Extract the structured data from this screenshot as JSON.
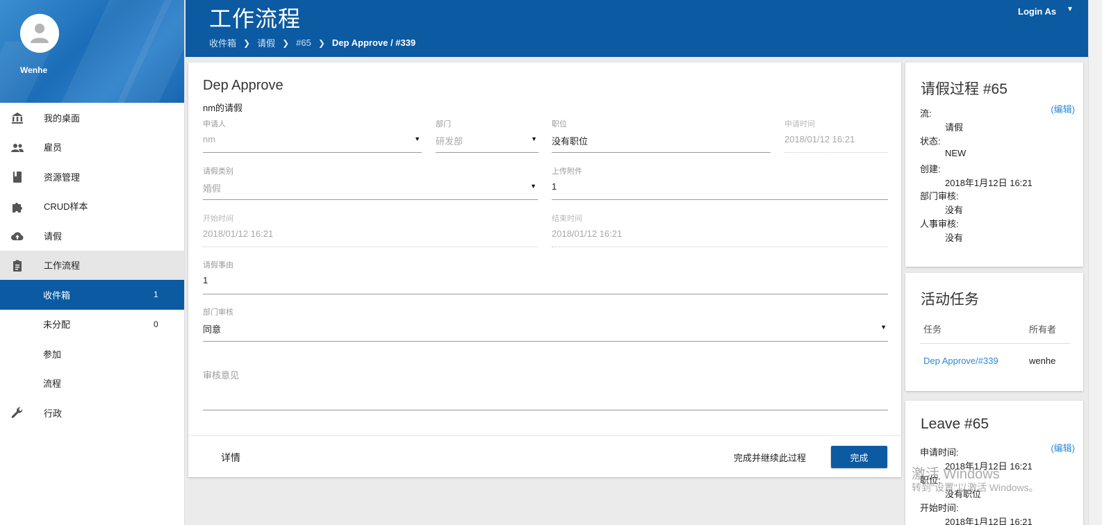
{
  "sidebar": {
    "username": "Wenhe",
    "items": [
      {
        "label": "我的桌面",
        "icon": "bank-icon"
      },
      {
        "label": "雇员",
        "icon": "people-icon"
      },
      {
        "label": "资源管理",
        "icon": "book-icon"
      },
      {
        "label": "CRUD样本",
        "icon": "puzzle-icon"
      },
      {
        "label": "请假",
        "icon": "cloud-upload-icon"
      },
      {
        "label": "工作流程",
        "icon": "clipboard-icon"
      }
    ],
    "sub_items": [
      {
        "label": "收件箱",
        "count": "1"
      },
      {
        "label": "未分配",
        "count": "0"
      },
      {
        "label": "参加",
        "count": ""
      },
      {
        "label": "流程",
        "count": ""
      }
    ],
    "admin": {
      "label": "行政",
      "icon": "wrench-icon"
    }
  },
  "header": {
    "title": "工作流程",
    "breadcrumb": [
      "收件箱",
      "请假",
      "#65",
      "Dep Approve / #339"
    ],
    "login_as": "Login As"
  },
  "form": {
    "title": "Dep Approve",
    "subtitle": "nm的请假",
    "applicant": {
      "label": "申请人",
      "value": "nm"
    },
    "department": {
      "label": "部门",
      "value": "研发部"
    },
    "position": {
      "label": "职位",
      "value": "没有职位"
    },
    "apply_time": {
      "label": "申请时间",
      "value": "2018/01/12 16:21"
    },
    "leave_type": {
      "label": "请假类别",
      "value": "婚假"
    },
    "attachment": {
      "label": "上传附件",
      "value": "1"
    },
    "start_time": {
      "label": "开始时间",
      "value": "2018/01/12 16:21"
    },
    "end_time": {
      "label": "结束时间",
      "value": "2018/01/12 16:21"
    },
    "reason": {
      "label": "请假事由",
      "value": "1"
    },
    "dept_review": {
      "label": "部门审核",
      "value": "同意"
    },
    "review_comment": {
      "label": "审核意见",
      "value": ""
    },
    "detail_button": "详情",
    "continue_button": "完成并继续此过程",
    "complete_button": "完成"
  },
  "process": {
    "title": "请假过程 #65",
    "edit": "(编辑)",
    "rows": [
      {
        "key": "流:",
        "value": "请假"
      },
      {
        "key": "状态:",
        "value": "NEW"
      },
      {
        "key": "创建:",
        "value": "2018年1月12日 16:21"
      },
      {
        "key": "部门审核:",
        "value": "没有"
      },
      {
        "key": "人事审核:",
        "value": "没有"
      }
    ]
  },
  "tasks": {
    "title": "活动任务",
    "col_task": "任务",
    "col_owner": "所有者",
    "row_task": "Dep Approve/#339",
    "row_owner": "wenhe"
  },
  "leave": {
    "title": "Leave #65",
    "edit": "(编辑)",
    "rows": [
      {
        "key": "申请时间:",
        "value": "2018年1月12日 16:21"
      },
      {
        "key": "职位:",
        "value": "没有职位"
      },
      {
        "key": "开始时间:",
        "value": "2018年1月12日 16:21"
      }
    ]
  },
  "watermark": {
    "line1": "激活 Windows",
    "line2": "转到\"设置\"以激活 Windows。"
  },
  "colors": {
    "primary": "#0b5aa2",
    "link": "#2a8ad6"
  }
}
